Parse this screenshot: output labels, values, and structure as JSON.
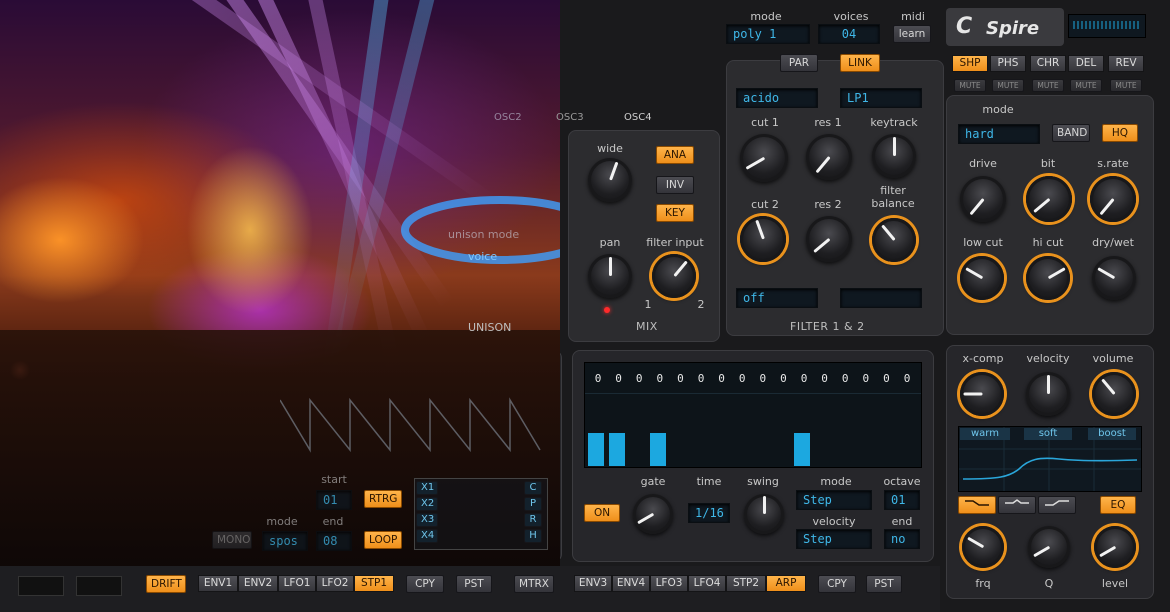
{
  "header": {
    "mode_label": "mode",
    "mode_value": "poly 1",
    "voices_label": "voices",
    "voices_value": "04",
    "midi_label": "midi",
    "midi_button": "learn",
    "logo": "Spire"
  },
  "osc": {
    "tabs": [
      "OSC2",
      "OSC3",
      "OSC4"
    ],
    "wide_label": "wide",
    "pan_label": "pan",
    "filter_input_label": "filter input",
    "ana": "ANA",
    "inv": "INV",
    "key": "KEY",
    "mix_label": "MIX",
    "fi_min": "1",
    "fi_max": "2",
    "unison_label": "UNISON",
    "unison_mode_label": "unison mode",
    "unison_mode_value": "voice"
  },
  "filter": {
    "par": "PAR",
    "link": "LINK",
    "type1": "acido",
    "type2": "LP1",
    "cut1": "cut 1",
    "res1": "res 1",
    "keytrack": "keytrack",
    "cut2": "cut 2",
    "res2": "res 2",
    "balance": "filter balance",
    "bottom_value": "off",
    "section": "FILTER 1 & 2"
  },
  "fx": {
    "tabs": [
      {
        "label": "SHP",
        "on": true
      },
      {
        "label": "PHS",
        "on": false
      },
      {
        "label": "CHR",
        "on": false
      },
      {
        "label": "DEL",
        "on": false
      },
      {
        "label": "REV",
        "on": false
      }
    ],
    "mute": "MUTE",
    "mode_label": "mode",
    "mode_value": "hard",
    "band": "BAND",
    "hq": "HQ",
    "drive": "drive",
    "bit": "bit",
    "srate": "s.rate",
    "lowcut": "low cut",
    "hicut": "hi cut",
    "drywet": "dry/wet"
  },
  "eq": {
    "xcomp": "x-comp",
    "velocity": "velocity",
    "volume": "volume",
    "warm": "warm",
    "soft": "soft",
    "boost": "boost",
    "eq_btn": "EQ",
    "frq": "frq",
    "q": "Q",
    "level": "level"
  },
  "step": {
    "start_label": "start",
    "start_value": "01",
    "end_label": "end",
    "end_value": "08",
    "mode_label": "mode",
    "mode_value": "spos",
    "rtrg": "RTRG",
    "loop": "LOOP",
    "mono": "MONO",
    "x_buttons": [
      "X1",
      "X2",
      "X3",
      "X4"
    ],
    "cprh": [
      "C",
      "P",
      "R",
      "H"
    ]
  },
  "arp": {
    "values": [
      "0",
      "0",
      "0",
      "0",
      "0",
      "0",
      "0",
      "0",
      "0",
      "0",
      "0",
      "0",
      "0",
      "0",
      "0",
      "0"
    ],
    "bars": [
      0.55,
      0.55,
      0,
      0.55,
      0,
      0,
      0,
      0,
      0,
      0,
      0.55,
      0,
      0,
      0,
      0,
      0
    ],
    "on": "ON",
    "gate_label": "gate",
    "time_label": "time",
    "time_value": "1/16",
    "swing_label": "swing",
    "mode_label": "mode",
    "mode_value": "Step",
    "octave_label": "octave",
    "octave_value": "01",
    "velocity_label": "velocity",
    "velocity_value": "Step",
    "end_label": "end",
    "end_value": "no"
  },
  "bottom_left": {
    "drift": "DRIFT",
    "tabs": [
      {
        "label": "ENV1",
        "on": false
      },
      {
        "label": "ENV2",
        "on": false
      },
      {
        "label": "LFO1",
        "on": false
      },
      {
        "label": "LFO2",
        "on": false
      },
      {
        "label": "STP1",
        "on": true
      }
    ],
    "cpy": "CPY",
    "pst": "PST",
    "mtrx": "MTRX"
  },
  "bottom_right": {
    "tabs": [
      {
        "label": "ENV3",
        "on": false
      },
      {
        "label": "ENV4",
        "on": false
      },
      {
        "label": "LFO3",
        "on": false
      },
      {
        "label": "LFO4",
        "on": false
      },
      {
        "label": "STP2",
        "on": false
      },
      {
        "label": "ARP",
        "on": true
      }
    ],
    "cpy": "CPY",
    "pst": "PST"
  },
  "colors": {
    "accent": "#ef8f1a",
    "lcd": "#1ca8e0",
    "panel": "#2c2c2f"
  }
}
